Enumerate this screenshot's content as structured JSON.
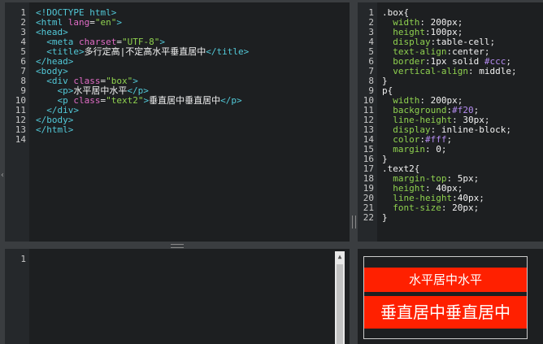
{
  "html_editor": {
    "line_numbers": [
      "1",
      "2",
      "3",
      "4",
      "5",
      "6",
      "7",
      "8",
      "9",
      "10",
      "11",
      "12",
      "13",
      "14"
    ],
    "lines": [
      [
        {
          "c": "t-tag",
          "t": "<!DOCTYPE html>"
        }
      ],
      [
        {
          "c": "t-tag",
          "t": "<html "
        },
        {
          "c": "t-attr",
          "t": "lang"
        },
        {
          "c": "t-pun",
          "t": "="
        },
        {
          "c": "t-str",
          "t": "\"en\""
        },
        {
          "c": "t-tag",
          "t": ">"
        }
      ],
      [
        {
          "c": "t-tag",
          "t": "<head>"
        }
      ],
      [
        {
          "c": "t-pun",
          "t": "  "
        },
        {
          "c": "t-tag",
          "t": "<meta "
        },
        {
          "c": "t-attr",
          "t": "charset"
        },
        {
          "c": "t-pun",
          "t": "="
        },
        {
          "c": "t-str",
          "t": "\"UTF-8\""
        },
        {
          "c": "t-tag",
          "t": ">"
        }
      ],
      [
        {
          "c": "t-pun",
          "t": "  "
        },
        {
          "c": "t-tag",
          "t": "<title>"
        },
        {
          "c": "t-txt",
          "t": "多行定高|不定高水平垂直居中"
        },
        {
          "c": "t-tag",
          "t": "</title>"
        }
      ],
      [
        {
          "c": "t-tag",
          "t": "</head>"
        }
      ],
      [
        {
          "c": "t-tag",
          "t": "<body>"
        }
      ],
      [
        {
          "c": "t-pun",
          "t": "  "
        },
        {
          "c": "t-tag",
          "t": "<div "
        },
        {
          "c": "t-attr",
          "t": "class"
        },
        {
          "c": "t-pun",
          "t": "="
        },
        {
          "c": "t-str",
          "t": "\"box\""
        },
        {
          "c": "t-tag",
          "t": ">"
        }
      ],
      [
        {
          "c": "t-pun",
          "t": "    "
        },
        {
          "c": "t-tag",
          "t": "<p>"
        },
        {
          "c": "t-txt",
          "t": "水平居中水平"
        },
        {
          "c": "t-tag",
          "t": "</p>"
        }
      ],
      [
        {
          "c": "t-pun",
          "t": "    "
        },
        {
          "c": "t-tag",
          "t": "<p "
        },
        {
          "c": "t-attr",
          "t": "class"
        },
        {
          "c": "t-pun",
          "t": "="
        },
        {
          "c": "t-str",
          "t": "\"text2\""
        },
        {
          "c": "t-tag",
          "t": ">"
        },
        {
          "c": "t-txt",
          "t": "垂直居中垂直居中"
        },
        {
          "c": "t-tag",
          "t": "</p>"
        }
      ],
      [
        {
          "c": "t-pun",
          "t": "  "
        },
        {
          "c": "t-tag",
          "t": "</div>"
        }
      ],
      [
        {
          "c": "t-tag",
          "t": "</body>"
        }
      ],
      [
        {
          "c": "t-tag",
          "t": "</html>"
        }
      ],
      []
    ]
  },
  "css_editor": {
    "line_numbers": [
      "1",
      "2",
      "3",
      "4",
      "5",
      "6",
      "7",
      "8",
      "9",
      "10",
      "11",
      "12",
      "13",
      "14",
      "15",
      "16",
      "17",
      "18",
      "19",
      "20",
      "21",
      "22"
    ],
    "lines": [
      [
        {
          "c": "t-sel",
          "t": ".box{"
        }
      ],
      [
        {
          "c": "t-pun",
          "t": "  "
        },
        {
          "c": "t-prop",
          "t": "width"
        },
        {
          "c": "t-pun",
          "t": ": "
        },
        {
          "c": "t-val",
          "t": "200px"
        },
        {
          "c": "t-pun",
          "t": ";"
        }
      ],
      [
        {
          "c": "t-pun",
          "t": "  "
        },
        {
          "c": "t-prop",
          "t": "height"
        },
        {
          "c": "t-pun",
          "t": ":"
        },
        {
          "c": "t-val",
          "t": "100px"
        },
        {
          "c": "t-pun",
          "t": ";"
        }
      ],
      [
        {
          "c": "t-pun",
          "t": "  "
        },
        {
          "c": "t-prop",
          "t": "display"
        },
        {
          "c": "t-pun",
          "t": ":"
        },
        {
          "c": "t-val",
          "t": "table-cell"
        },
        {
          "c": "t-pun",
          "t": ";"
        }
      ],
      [
        {
          "c": "t-pun",
          "t": "  "
        },
        {
          "c": "t-prop",
          "t": "text-align"
        },
        {
          "c": "t-pun",
          "t": ":"
        },
        {
          "c": "t-val",
          "t": "center"
        },
        {
          "c": "t-pun",
          "t": ";"
        }
      ],
      [
        {
          "c": "t-pun",
          "t": "  "
        },
        {
          "c": "t-prop",
          "t": "border"
        },
        {
          "c": "t-pun",
          "t": ":"
        },
        {
          "c": "t-val",
          "t": "1px solid "
        },
        {
          "c": "t-hex",
          "t": "#ccc"
        },
        {
          "c": "t-pun",
          "t": ";"
        }
      ],
      [
        {
          "c": "t-pun",
          "t": "  "
        },
        {
          "c": "t-prop",
          "t": "vertical-align"
        },
        {
          "c": "t-pun",
          "t": ": "
        },
        {
          "c": "t-val",
          "t": "middle"
        },
        {
          "c": "t-pun",
          "t": ";"
        }
      ],
      [
        {
          "c": "t-sel",
          "t": "}"
        }
      ],
      [
        {
          "c": "t-sel",
          "t": "p{"
        }
      ],
      [
        {
          "c": "t-pun",
          "t": "  "
        },
        {
          "c": "t-prop",
          "t": "width"
        },
        {
          "c": "t-pun",
          "t": ": "
        },
        {
          "c": "t-val",
          "t": "200px"
        },
        {
          "c": "t-pun",
          "t": ";"
        }
      ],
      [
        {
          "c": "t-pun",
          "t": "  "
        },
        {
          "c": "t-prop",
          "t": "background"
        },
        {
          "c": "t-pun",
          "t": ":"
        },
        {
          "c": "t-hex",
          "t": "#f20"
        },
        {
          "c": "t-pun",
          "t": ";"
        }
      ],
      [
        {
          "c": "t-pun",
          "t": "  "
        },
        {
          "c": "t-prop",
          "t": "line-height"
        },
        {
          "c": "t-pun",
          "t": ": "
        },
        {
          "c": "t-val",
          "t": "30px"
        },
        {
          "c": "t-pun",
          "t": ";"
        }
      ],
      [
        {
          "c": "t-pun",
          "t": "  "
        },
        {
          "c": "t-prop",
          "t": "display"
        },
        {
          "c": "t-pun",
          "t": ": "
        },
        {
          "c": "t-val",
          "t": "inline-block"
        },
        {
          "c": "t-pun",
          "t": ";"
        }
      ],
      [
        {
          "c": "t-pun",
          "t": "  "
        },
        {
          "c": "t-prop",
          "t": "color"
        },
        {
          "c": "t-pun",
          "t": ":"
        },
        {
          "c": "t-hex",
          "t": "#fff"
        },
        {
          "c": "t-pun",
          "t": ";"
        }
      ],
      [
        {
          "c": "t-pun",
          "t": "  "
        },
        {
          "c": "t-prop",
          "t": "margin"
        },
        {
          "c": "t-pun",
          "t": ": "
        },
        {
          "c": "t-val",
          "t": "0"
        },
        {
          "c": "t-pun",
          "t": ";"
        }
      ],
      [
        {
          "c": "t-sel",
          "t": "}"
        }
      ],
      [
        {
          "c": "t-sel",
          "t": ".text2{"
        }
      ],
      [
        {
          "c": "t-pun",
          "t": "  "
        },
        {
          "c": "t-prop",
          "t": "margin-top"
        },
        {
          "c": "t-pun",
          "t": ": "
        },
        {
          "c": "t-val",
          "t": "5px"
        },
        {
          "c": "t-pun",
          "t": ";"
        }
      ],
      [
        {
          "c": "t-pun",
          "t": "  "
        },
        {
          "c": "t-prop",
          "t": "height"
        },
        {
          "c": "t-pun",
          "t": ": "
        },
        {
          "c": "t-val",
          "t": "40px"
        },
        {
          "c": "t-pun",
          "t": ";"
        }
      ],
      [
        {
          "c": "t-pun",
          "t": "  "
        },
        {
          "c": "t-prop",
          "t": "line-height"
        },
        {
          "c": "t-pun",
          "t": ":"
        },
        {
          "c": "t-val",
          "t": "40px"
        },
        {
          "c": "t-pun",
          "t": ";"
        }
      ],
      [
        {
          "c": "t-pun",
          "t": "  "
        },
        {
          "c": "t-prop",
          "t": "font-size"
        },
        {
          "c": "t-pun",
          "t": ": "
        },
        {
          "c": "t-val",
          "t": "20px"
        },
        {
          "c": "t-pun",
          "t": ";"
        }
      ],
      [
        {
          "c": "t-sel",
          "t": "}"
        }
      ]
    ]
  },
  "js_editor": {
    "line_numbers": [
      "1"
    ],
    "scroll_up_icon": "▲"
  },
  "preview": {
    "line1": "水平居中水平",
    "line2": "垂直居中垂直居中"
  },
  "colors": {
    "editor_bg": "#1d1f21",
    "gutter_bg": "#25282b",
    "preview_red": "#ff2000",
    "preview_border": "#cccccc"
  }
}
